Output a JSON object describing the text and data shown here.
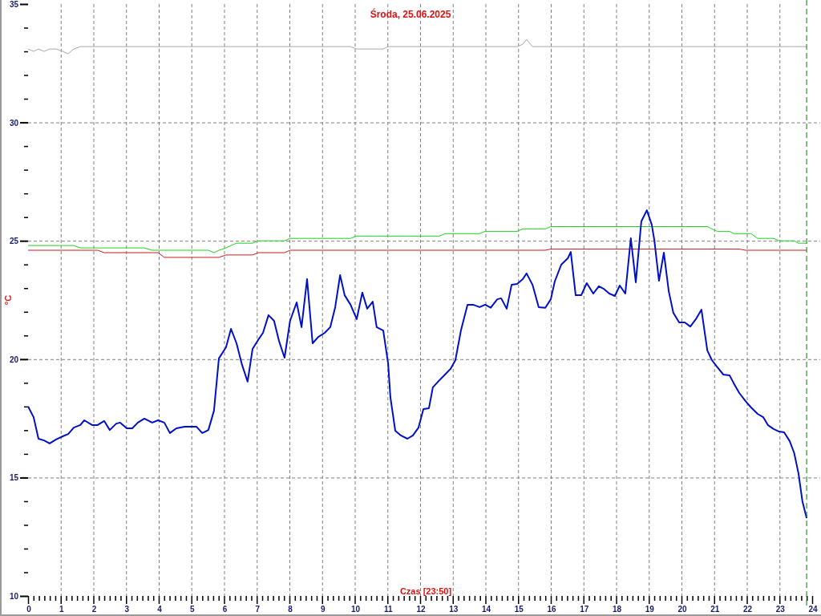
{
  "chart": {
    "chart_data": {
      "type": "line",
      "title": "Środa, 25.06.2025",
      "xlabel": "Czas [23:50]",
      "ylabel": "°C",
      "xlim": [
        0,
        24
      ],
      "ylim": [
        10,
        35
      ],
      "xticks": [
        0,
        1,
        2,
        3,
        4,
        5,
        6,
        7,
        8,
        9,
        10,
        11,
        12,
        13,
        14,
        15,
        16,
        17,
        18,
        19,
        20,
        21,
        22,
        23,
        24
      ],
      "yticks": [
        10,
        15,
        20,
        25,
        30,
        35
      ],
      "x": [
        0,
        0.17,
        0.32,
        0.49,
        0.66,
        0.86,
        1.06,
        1.23,
        1.4,
        1.6,
        1.72,
        1.96,
        2.13,
        2.33,
        2.5,
        2.7,
        2.82,
        3.02,
        3.19,
        3.36,
        3.56,
        3.8,
        3.98,
        4.17,
        4.34,
        4.54,
        4.79,
        5.15,
        5.33,
        5.52,
        5.69,
        5.84,
        6.06,
        6.21,
        6.38,
        6.55,
        6.72,
        6.87,
        7.04,
        7.19,
        7.36,
        7.53,
        7.68,
        7.85,
        8.02,
        8.22,
        8.37,
        8.54,
        8.71,
        8.88,
        9.08,
        9.25,
        9.4,
        9.55,
        9.69,
        9.87,
        10.06,
        10.23,
        10.38,
        10.55,
        10.67,
        10.87,
        11.02,
        11.09,
        11.24,
        11.41,
        11.61,
        11.78,
        11.95,
        12.1,
        12.27,
        12.39,
        12.59,
        12.76,
        12.93,
        13.08,
        13.25,
        13.45,
        13.62,
        13.82,
        13.99,
        14.16,
        14.36,
        14.48,
        14.65,
        14.8,
        14.97,
        15.14,
        15.26,
        15.44,
        15.63,
        15.83,
        16,
        16.12,
        16.32,
        16.52,
        16.61,
        16.76,
        16.93,
        17.1,
        17.3,
        17.47,
        17.62,
        17.79,
        17.96,
        18.11,
        18.28,
        18.45,
        18.6,
        18.77,
        18.94,
        19.09,
        19.17,
        19.31,
        19.46,
        19.61,
        19.75,
        19.93,
        20.1,
        20.27,
        20.44,
        20.61,
        20.79,
        20.93,
        21.1,
        21.28,
        21.47,
        21.6,
        21.77,
        21.96,
        22.13,
        22.33,
        22.5,
        22.65,
        22.82,
        22.99,
        23.14,
        23.31,
        23.45,
        23.58,
        23.7,
        23.83
      ],
      "series": [
        {
          "color": "#a8a8a8",
          "values": [
            33.1,
            33,
            33.1,
            33,
            33.1,
            33.1,
            33,
            32.9,
            33.1,
            33.2,
            33.2,
            33.2,
            33.2,
            33.2,
            33.2,
            33.2,
            33.2,
            33.2,
            33.2,
            33.2,
            33.2,
            33.2,
            33.2,
            33.2,
            33.2,
            33.2,
            33.2,
            33.2,
            33.2,
            33.2,
            33.2,
            33.2,
            33.2,
            33.2,
            33.2,
            33.2,
            33.2,
            33.2,
            33.2,
            33.2,
            33.2,
            33.2,
            33.2,
            33.2,
            33.2,
            33.2,
            33.2,
            33.2,
            33.2,
            33.2,
            33.2,
            33.2,
            33.2,
            33.2,
            33.2,
            33.2,
            33.1,
            33.1,
            33.1,
            33.1,
            33.1,
            33.1,
            33.2,
            33.2,
            33.2,
            33.2,
            33.2,
            33.2,
            33.2,
            33.2,
            33.2,
            33.2,
            33.2,
            33.2,
            33.2,
            33.2,
            33.2,
            33.2,
            33.2,
            33.2,
            33.2,
            33.2,
            33.2,
            33.2,
            33.2,
            33.2,
            33.2,
            33.3,
            33.5,
            33.2,
            33.2,
            33.2,
            33.2,
            33.2,
            33.2,
            33.2,
            33.2,
            33.2,
            33.2,
            33.2,
            33.2,
            33.2,
            33.2,
            33.2,
            33.2,
            33.2,
            33.2,
            33.2,
            33.2,
            33.2,
            33.2,
            33.2,
            33.2,
            33.2,
            33.2,
            33.2,
            33.2,
            33.2,
            33.2,
            33.2,
            33.2,
            33.2,
            33.2,
            33.2,
            33.2,
            33.2,
            33.2,
            33.2,
            33.2,
            33.2,
            33.2,
            33.2,
            33.2,
            33.2,
            33.2,
            33.2,
            33.2,
            33.2,
            33.2,
            33.2,
            33.2,
            33.2
          ]
        },
        {
          "color": "#20d020",
          "values": [
            24.8,
            24.8,
            24.8,
            24.8,
            24.8,
            24.8,
            24.8,
            24.8,
            24.8,
            24.7,
            24.7,
            24.7,
            24.7,
            24.7,
            24.7,
            24.7,
            24.7,
            24.7,
            24.7,
            24.7,
            24.7,
            24.6,
            24.6,
            24.6,
            24.6,
            24.6,
            24.6,
            24.6,
            24.6,
            24.6,
            24.5,
            24.6,
            24.7,
            24.8,
            24.9,
            24.9,
            24.9,
            24.9,
            25,
            25,
            25,
            25,
            25,
            25,
            25.1,
            25.1,
            25.1,
            25.1,
            25.1,
            25.1,
            25.1,
            25.1,
            25.1,
            25.1,
            25.1,
            25.1,
            25.2,
            25.2,
            25.2,
            25.2,
            25.2,
            25.2,
            25.2,
            25.2,
            25.2,
            25.2,
            25.2,
            25.2,
            25.2,
            25.2,
            25.2,
            25.2,
            25.2,
            25.3,
            25.3,
            25.3,
            25.3,
            25.3,
            25.3,
            25.3,
            25.4,
            25.4,
            25.4,
            25.4,
            25.4,
            25.4,
            25.4,
            25.5,
            25.5,
            25.5,
            25.5,
            25.5,
            25.6,
            25.6,
            25.6,
            25.6,
            25.6,
            25.6,
            25.6,
            25.6,
            25.6,
            25.6,
            25.6,
            25.6,
            25.6,
            25.6,
            25.6,
            25.6,
            25.6,
            25.6,
            25.6,
            25.6,
            25.6,
            25.6,
            25.6,
            25.6,
            25.6,
            25.6,
            25.6,
            25.6,
            25.6,
            25.6,
            25.6,
            25.5,
            25.4,
            25.4,
            25.4,
            25.3,
            25.3,
            25.3,
            25.3,
            25.1,
            25.1,
            25.1,
            25.1,
            25,
            25,
            25,
            25,
            24.9,
            24.9,
            24.9
          ]
        },
        {
          "color": "#cc1c1c",
          "values": [
            24.6,
            24.6,
            24.6,
            24.6,
            24.6,
            24.6,
            24.6,
            24.6,
            24.6,
            24.6,
            24.6,
            24.6,
            24.6,
            24.5,
            24.5,
            24.5,
            24.5,
            24.5,
            24.5,
            24.5,
            24.5,
            24.5,
            24.5,
            24.3,
            24.3,
            24.3,
            24.3,
            24.3,
            24.3,
            24.3,
            24.3,
            24.3,
            24.4,
            24.4,
            24.4,
            24.4,
            24.4,
            24.4,
            24.5,
            24.5,
            24.5,
            24.5,
            24.5,
            24.5,
            24.6,
            24.6,
            24.6,
            24.6,
            24.6,
            24.6,
            24.6,
            24.6,
            24.6,
            24.6,
            24.6,
            24.6,
            24.6,
            24.6,
            24.6,
            24.6,
            24.6,
            24.6,
            24.6,
            24.6,
            24.6,
            24.6,
            24.6,
            24.6,
            24.6,
            24.6,
            24.6,
            24.6,
            24.6,
            24.6,
            24.6,
            24.6,
            24.6,
            24.6,
            24.6,
            24.6,
            24.6,
            24.6,
            24.6,
            24.6,
            24.6,
            24.6,
            24.6,
            24.6,
            24.6,
            24.6,
            24.6,
            24.6,
            24.65,
            24.65,
            24.65,
            24.65,
            24.65,
            24.65,
            24.65,
            24.65,
            24.65,
            24.65,
            24.65,
            24.65,
            24.65,
            24.65,
            24.65,
            24.65,
            24.65,
            24.65,
            24.65,
            24.65,
            24.65,
            24.65,
            24.65,
            24.65,
            24.65,
            24.65,
            24.65,
            24.65,
            24.65,
            24.65,
            24.65,
            24.65,
            24.65,
            24.65,
            24.65,
            24.65,
            24.65,
            24.6,
            24.6,
            24.6,
            24.6,
            24.6,
            24.6,
            24.6,
            24.6,
            24.6,
            24.6,
            24.6,
            24.6,
            24.6
          ]
        },
        {
          "color": "#0010c8",
          "values": [
            18,
            17.55,
            16.64,
            16.57,
            16.44,
            16.61,
            16.74,
            16.84,
            17.11,
            17.22,
            17.42,
            17.22,
            17.22,
            17.39,
            17.01,
            17.28,
            17.32,
            17.08,
            17.08,
            17.32,
            17.49,
            17.32,
            17.42,
            17.32,
            16.88,
            17.08,
            17.15,
            17.15,
            16.88,
            17.01,
            17.83,
            20.03,
            20.5,
            21.28,
            20.67,
            19.76,
            19.05,
            20.43,
            20.81,
            21.11,
            21.86,
            21.62,
            20.77,
            20.06,
            21.62,
            22.4,
            21.35,
            23.38,
            20.67,
            20.94,
            21.11,
            21.35,
            22.2,
            23.55,
            22.7,
            22.3,
            21.69,
            22.81,
            22.13,
            22.43,
            21.35,
            21.21,
            19.82,
            18.4,
            16.98,
            16.78,
            16.64,
            16.78,
            17.11,
            17.89,
            17.93,
            18.81,
            19.11,
            19.35,
            19.59,
            19.96,
            21.21,
            22.3,
            22.3,
            22.2,
            22.3,
            22.17,
            22.53,
            22.57,
            22.13,
            23.14,
            23.18,
            23.38,
            23.62,
            23.14,
            22.2,
            22.17,
            22.53,
            23.28,
            23.99,
            24.26,
            24.53,
            22.7,
            22.7,
            23.21,
            22.77,
            23.08,
            22.97,
            22.77,
            22.67,
            23.11,
            22.77,
            25.11,
            23.25,
            25.82,
            26.29,
            25.68,
            25.01,
            23.31,
            24.5,
            22.87,
            21.96,
            21.55,
            21.55,
            21.38,
            21.69,
            22.09,
            20.37,
            19.96,
            19.66,
            19.35,
            19.32,
            18.98,
            18.57,
            18.23,
            17.96,
            17.69,
            17.55,
            17.21,
            17.05,
            16.94,
            16.91,
            16.54,
            16.03,
            15.18,
            14,
            13.29
          ]
        }
      ],
      "grid": true,
      "ref_lines": [
        {
          "axis": "x",
          "value": 23.83
        }
      ]
    }
  }
}
